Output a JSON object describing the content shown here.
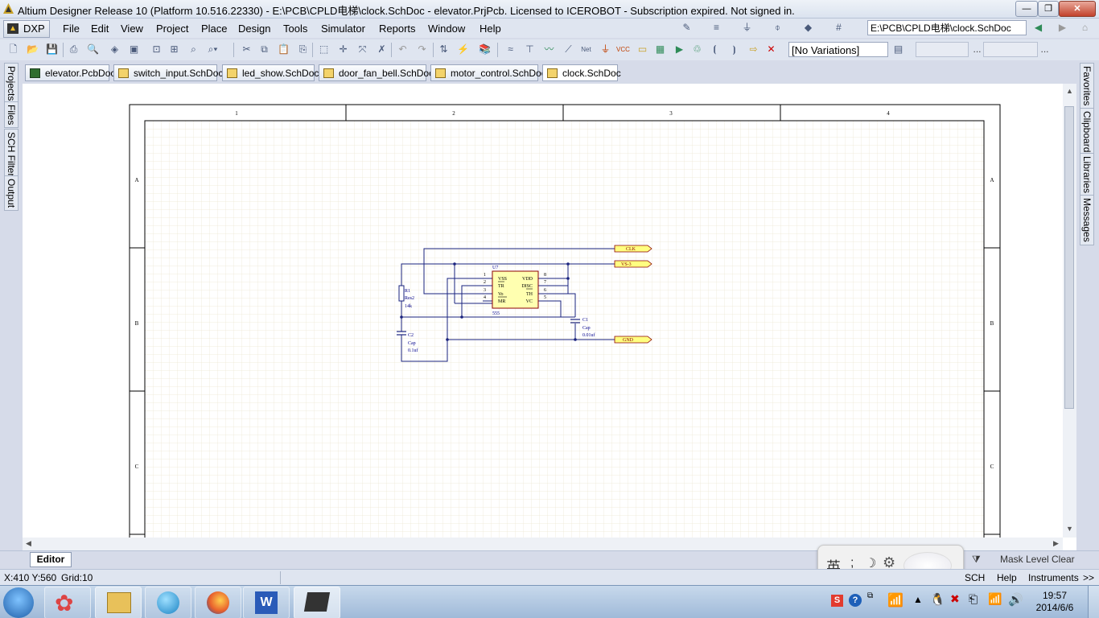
{
  "window": {
    "title": "Altium Designer Release 10 (Platform 10.516.22330) - E:\\PCB\\CPLD电梯\\clock.SchDoc - elevator.PrjPcb. Licensed to ICEROBOT - Subscription expired. Not signed in.",
    "min": "—",
    "max": "❐",
    "close": "✕"
  },
  "menubar": {
    "dxp": "DXP",
    "items": [
      "File",
      "Edit",
      "View",
      "Project",
      "Place",
      "Design",
      "Tools",
      "Simulator",
      "Reports",
      "Window",
      "Help"
    ],
    "path": "E:\\PCB\\CPLD电梯\\clock.SchDoc"
  },
  "toolbar": {
    "variations": "[No Variations]",
    "ellipsis": "..."
  },
  "tabs": [
    {
      "label": "elevator.PcbDoc",
      "icon": "pcb-doc-icon"
    },
    {
      "label": "switch_input.SchDoc",
      "icon": "sch-doc-icon"
    },
    {
      "label": "led_show.SchDoc",
      "icon": "sch-doc-icon"
    },
    {
      "label": "door_fan_bell.SchDoc",
      "icon": "sch-doc-icon"
    },
    {
      "label": "motor_control.SchDoc",
      "icon": "sch-doc-icon"
    },
    {
      "label": "clock.SchDoc",
      "icon": "sch-doc-icon"
    }
  ],
  "left_panels": [
    "Projects",
    "Files",
    "SCH Filter",
    "Output"
  ],
  "right_panels": [
    "Favorites",
    "Clipboard",
    "Libraries",
    "Messages"
  ],
  "sheet": {
    "columns": [
      "1",
      "2",
      "3",
      "4"
    ],
    "rows": [
      "A",
      "B",
      "C"
    ]
  },
  "schematic": {
    "ic_designator": "U7",
    "ic_value": "555",
    "pins_left": [
      "1",
      "2",
      "3",
      "4"
    ],
    "pins_right": [
      "8",
      "7",
      "6",
      "5"
    ],
    "pinnames_left": [
      "VSS",
      "TR",
      "Vo",
      "MR"
    ],
    "pinnames_right": [
      "VDD",
      "DISC",
      "TH",
      "VC"
    ],
    "r1": {
      "designator": "R1",
      "value": "Res2",
      "param": "14k"
    },
    "c1": {
      "designator": "C1",
      "value": "Cap",
      "param": "0.01uf"
    },
    "c2": {
      "designator": "C2",
      "value": "Cap",
      "param": "0.1uf"
    },
    "ports": [
      "CLK",
      "VS-3",
      "GND"
    ]
  },
  "editor_tab": "Editor",
  "mask_level": "Mask Level",
  "clear": "Clear",
  "ime": {
    "lang": "英",
    "punct": ";",
    "moon": "☽"
  },
  "status": {
    "coords": "X:410 Y:560",
    "grid": "Grid:10",
    "sch": "SCH",
    "help": "Help",
    "instruments": "Instruments",
    "more": ">>"
  },
  "taskbar": {
    "time": "19:57",
    "date": "2014/6/6"
  },
  "colors": {
    "wire": "#1a237e",
    "port_fill": "#ffff80",
    "port_border": "#8b0000",
    "ic_fill": "#ffffb0",
    "sheet_border": "#000000",
    "grid": "#ece6d2"
  }
}
